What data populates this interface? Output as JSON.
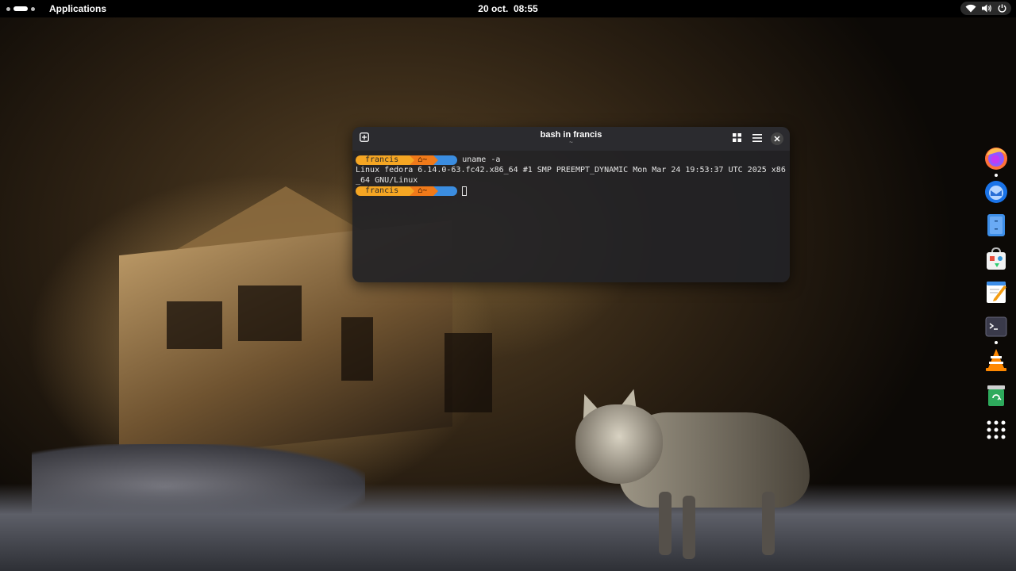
{
  "topbar": {
    "applications_label": "Applications",
    "date": "20 oct.",
    "time": "08:55"
  },
  "terminal": {
    "title": "bash in francis",
    "subtitle": "~",
    "lines": [
      {
        "user": "francis",
        "dir": "~",
        "command": "uname -a"
      },
      {
        "output": "Linux fedora 6.14.0-63.fc42.x86_64 #1 SMP PREEMPT_DYNAMIC Mon Mar 24 19:53:37 UTC 2025 x86"
      },
      {
        "output": "_64 GNU/Linux"
      },
      {
        "user": "francis",
        "dir": "~",
        "command": ""
      }
    ]
  },
  "dock": {
    "apps": [
      "firefox-icon",
      "thunderbird-icon",
      "files-icon",
      "software-icon",
      "text-editor-icon",
      "terminal-icon",
      "vlc-icon",
      "trash-icon",
      "app-grid-icon"
    ],
    "running": [
      "firefox-icon",
      "terminal-icon"
    ]
  },
  "colors": {
    "prompt_user": "#f5a623",
    "prompt_dir": "#f07a1a",
    "prompt_git": "#3b8de0",
    "terminal_bg": "#222226",
    "topbar_bg": "#000000"
  }
}
